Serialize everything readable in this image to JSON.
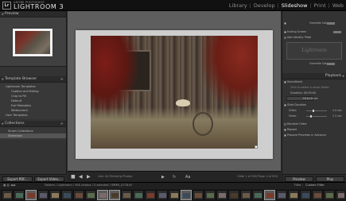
{
  "app": {
    "logo": "Lr",
    "brand_small": "ADOBE PHOTOSHOP",
    "brand_big": "LIGHTROOM 3"
  },
  "modules": [
    {
      "label": "Library",
      "active": false
    },
    {
      "label": "Develop",
      "active": false
    },
    {
      "label": "Slideshow",
      "active": true
    },
    {
      "label": "Print",
      "active": false
    },
    {
      "label": "Web",
      "active": false
    }
  ],
  "left": {
    "preview_title": "Preview",
    "template_title": "Template Browser",
    "templates": [
      {
        "label": "Lightroom Templates",
        "folder": true
      },
      {
        "label": "Caption and Rating",
        "folder": false
      },
      {
        "label": "Crop to Fill",
        "folder": false
      },
      {
        "label": "Default",
        "folder": false
      },
      {
        "label": "Exif Metadata",
        "folder": false
      },
      {
        "label": "Widescreen",
        "folder": false
      },
      {
        "label": "User Templates",
        "folder": true
      }
    ],
    "collections_title": "Collections",
    "collections": [
      {
        "label": "Smart Collections",
        "selected": false
      },
      {
        "label": "Slideshow",
        "selected": true
      }
    ],
    "export_pdf": "Export PDF...",
    "export_video": "Export Video..."
  },
  "center": {
    "play_controls": [
      "■",
      "◀",
      "▶"
    ],
    "theme_label": "Aa",
    "info_left": "Use: All Filmstrip Photos",
    "info_right": "Slide 1 of 900  Page 1 of 900"
  },
  "right": {
    "rows_top": [
      {
        "label": "Override Color",
        "checked": true
      },
      {
        "label": "Ending Screen",
        "checked": true
      },
      {
        "label": "Add Identity Plate",
        "checked": false
      }
    ],
    "identity_plate": "Lightroom",
    "override_color_2": "Override Color",
    "playback_title": "Playback",
    "soundtrack": "Soundtrack",
    "soundtrack_sub": "Click to select a music folder",
    "duration": "Duration: 00:00:00",
    "fit_to_music": "Fit to Music",
    "slide_duration": "Slide Duration",
    "sliders": [
      {
        "label": "Slides",
        "value": "4.0 sec",
        "pos": 0.32
      },
      {
        "label": "Fades",
        "value": "2.5 sec",
        "pos": 0.2
      }
    ],
    "random_order": "Random Order",
    "repeat": "Repeat",
    "prepare_previews": "Prepare Previews in Advance",
    "preview_btn": "Preview",
    "play_btn": "Play"
  },
  "filmstrip": {
    "path": "Folders / Lightroom / 900 photos / 5 selected / IMMN_0178.tif",
    "filter_label": "Filter :",
    "filter_value": "Custom Filter",
    "thumb_count": 30,
    "selected_indices": [
      2,
      8,
      9,
      15,
      22
    ]
  }
}
